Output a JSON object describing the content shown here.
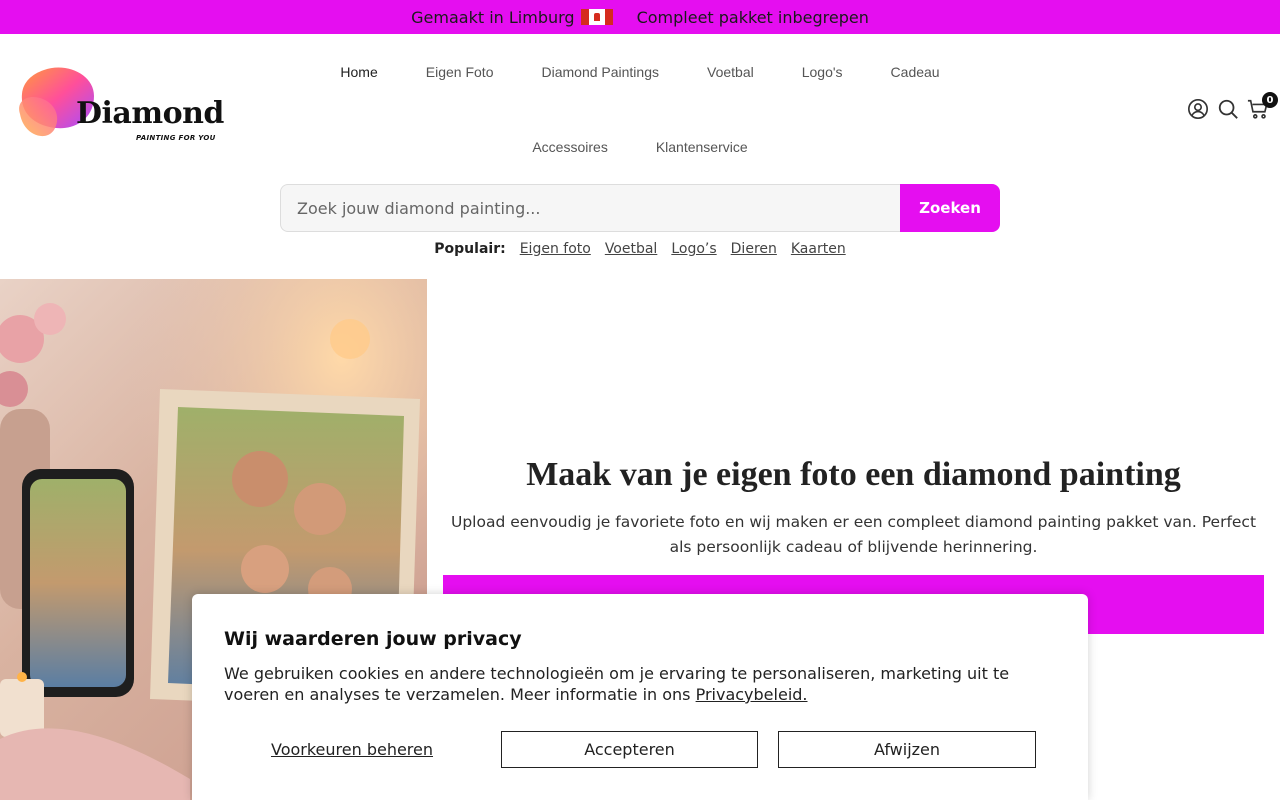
{
  "announcement": {
    "left_text": "Gemaakt in Limburg",
    "right_text": "Compleet pakket inbegrepen",
    "bg_color": "#e50ef0"
  },
  "logo": {
    "word": "Diamond",
    "tagline": "PAINTING FOR YOU"
  },
  "nav": {
    "items": [
      {
        "label": "Home",
        "active": true
      },
      {
        "label": "Eigen Foto"
      },
      {
        "label": "Diamond Paintings"
      },
      {
        "label": "Voetbal"
      },
      {
        "label": "Logo's"
      },
      {
        "label": "Cadeau"
      },
      {
        "label": "Accessoires"
      },
      {
        "label": "Klantenservice"
      }
    ]
  },
  "header_icons": {
    "account": "user-circle-icon",
    "search": "search-icon",
    "cart": "cart-icon",
    "cart_count": "0"
  },
  "search": {
    "placeholder": "Zoek jouw diamond painting...",
    "button": "Zoeken"
  },
  "popular": {
    "label": "Populair:",
    "links": [
      "Eigen foto",
      "Voetbal",
      "Logo’s",
      "Dieren",
      "Kaarten"
    ]
  },
  "hero": {
    "title": "Maak van je eigen foto een diamond painting",
    "description": "Upload eenvoudig je favoriete foto en wij maken er een compleet diamond painting pakket van. Perfect als persoonlijk cadeau of blijvende herinnering."
  },
  "cookie": {
    "title": "Wij waarderen jouw privacy",
    "body": "We gebruiken cookies en andere technologieën om je ervaring te personaliseren, marketing uit te voeren en analyses te verzamelen. Meer informatie in ons",
    "link": "Privacybeleid.",
    "prefs": "Voorkeuren beheren",
    "accept": "Accepteren",
    "reject": "Afwijzen"
  }
}
